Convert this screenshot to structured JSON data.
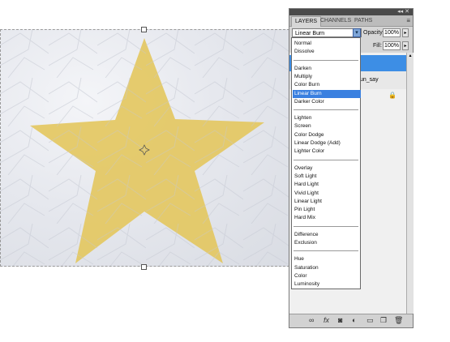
{
  "panel": {
    "tabs": [
      "LAYERS",
      "CHANNELS",
      "PATHS"
    ],
    "active_tab": "LAYERS",
    "top_controls": "◂◂ ✕",
    "menu_icon": "≡",
    "blend_mode": "Linear Burn",
    "opacity_label": "Opacity:",
    "opacity_value": "100%",
    "fill_label": "Fill:",
    "fill_value": "100%",
    "layer_name_partial": "un_say",
    "lock_icon": "lock-icon"
  },
  "blend_groups": [
    [
      "Normal",
      "Dissolve"
    ],
    [
      "Darken",
      "Multiply",
      "Color Burn",
      "Linear Burn",
      "Darker Color"
    ],
    [
      "Lighten",
      "Screen",
      "Color Dodge",
      "Linear Dodge (Add)",
      "Lighter Color"
    ],
    [
      "Overlay",
      "Soft Light",
      "Hard Light",
      "Vivid Light",
      "Linear Light",
      "Pin Light",
      "Hard Mix"
    ],
    [
      "Difference",
      "Exclusion"
    ],
    [
      "Hue",
      "Saturation",
      "Color",
      "Luminosity"
    ]
  ],
  "selected_option": "Linear Burn",
  "bottom_icons": [
    "link-icon",
    "fx-icon",
    "mask-icon",
    "adjustment-icon",
    "folder-icon",
    "new-layer-icon",
    "trash-icon"
  ],
  "colors": {
    "star": "#e3c75e",
    "highlight": "#3a80e0"
  }
}
